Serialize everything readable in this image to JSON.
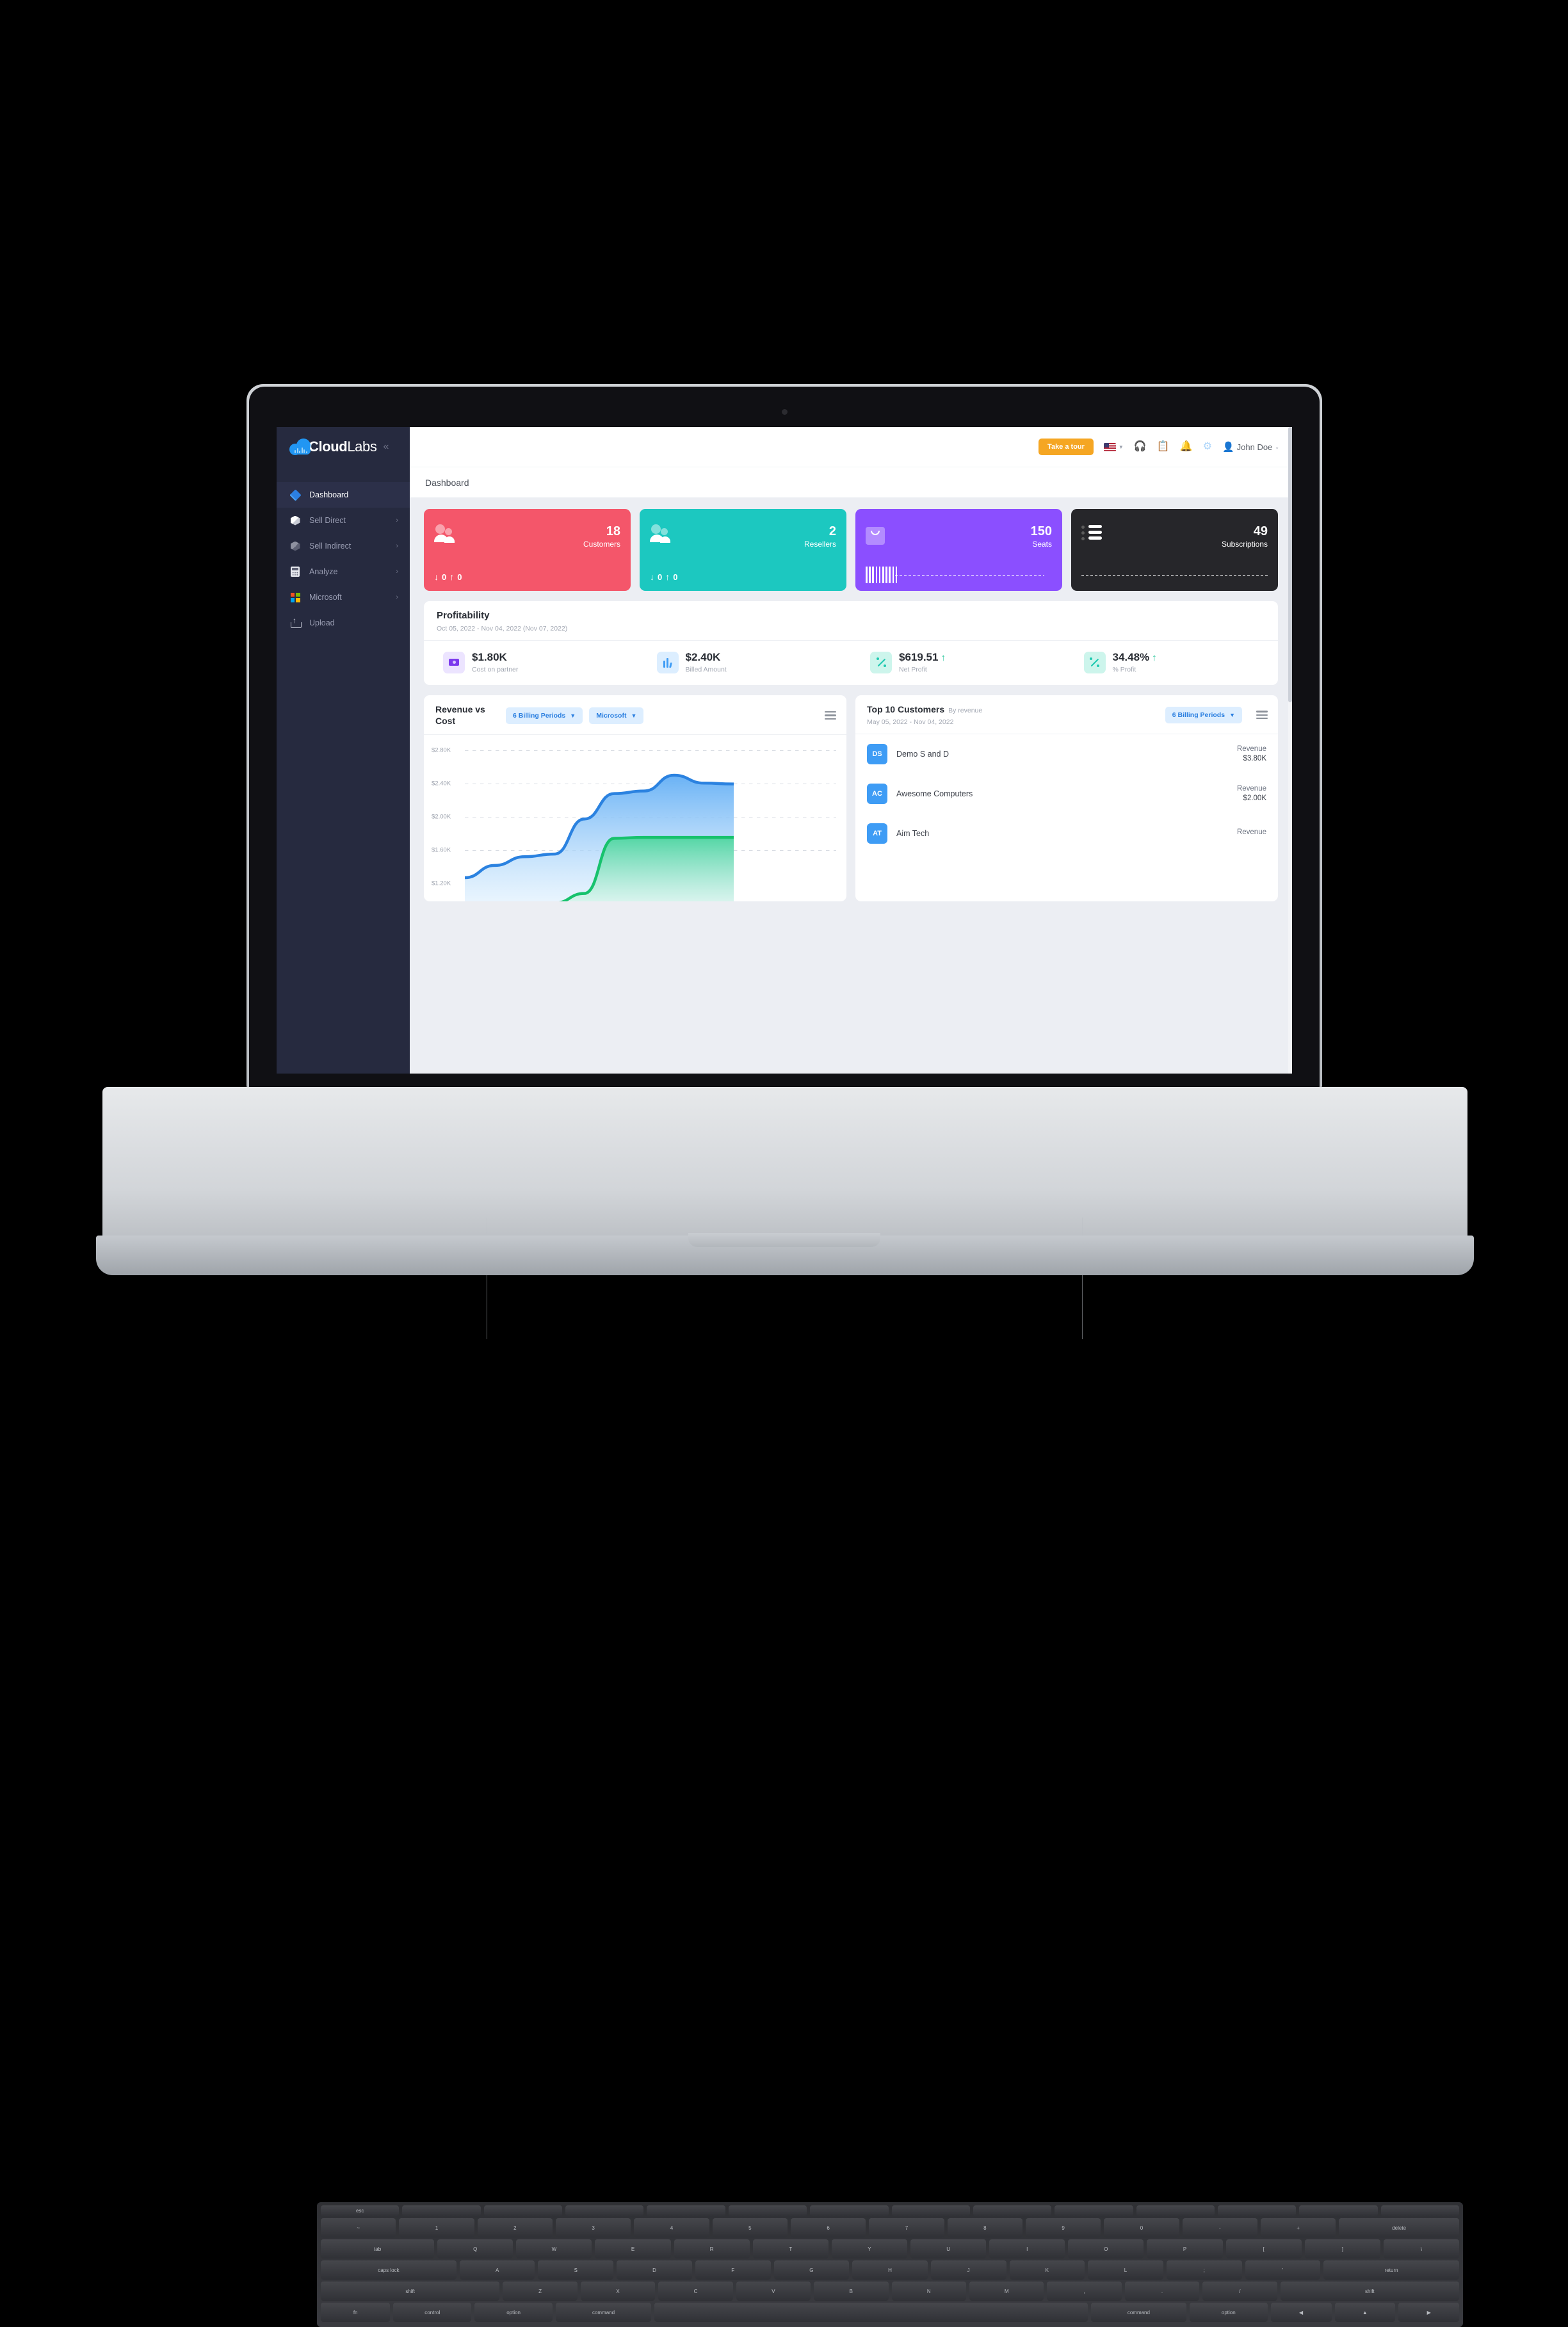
{
  "app": {
    "logo_main": "Cloud",
    "logo_sub": "Labs",
    "collapse_icon": "«"
  },
  "sidebar": {
    "items": [
      {
        "label": "Dashboard",
        "icon": "diamond-icon",
        "active": true,
        "chevron": ""
      },
      {
        "label": "Sell Direct",
        "icon": "cube-icon",
        "active": false,
        "chevron": "›"
      },
      {
        "label": "Sell Indirect",
        "icon": "cube-grey-icon",
        "active": false,
        "chevron": "›"
      },
      {
        "label": "Analyze",
        "icon": "calculator-icon",
        "active": false,
        "chevron": "›"
      },
      {
        "label": "Microsoft",
        "icon": "microsoft-icon",
        "active": false,
        "chevron": "›"
      },
      {
        "label": "Upload",
        "icon": "upload-icon",
        "active": false,
        "chevron": ""
      }
    ]
  },
  "topbar": {
    "take_tour": "Take a tour",
    "language_flag": "us-flag-icon",
    "icons": [
      "headset-icon",
      "clipboard-icon",
      "bell-icon",
      "gear-icon"
    ],
    "user_name": "John Doe",
    "user_caret": "⌄"
  },
  "page": {
    "title": "Dashboard"
  },
  "stat_cards": [
    {
      "value": "18",
      "label": "Customers",
      "color": "#f4566a",
      "down": "0",
      "up": "0",
      "icon": "people-icon"
    },
    {
      "value": "2",
      "label": "Resellers",
      "color": "#1cc8c0",
      "down": "0",
      "up": "0",
      "icon": "people-icon"
    },
    {
      "value": "150",
      "label": "Seats",
      "color": "#8b4fff",
      "icon": "bag-icon"
    },
    {
      "value": "49",
      "label": "Subscriptions",
      "color": "#26262a",
      "icon": "list-icon"
    }
  ],
  "profitability": {
    "title": "Profitability",
    "date_range": "Oct 05, 2022 - Nov 04, 2022 (Nov 07, 2022)",
    "metrics": [
      {
        "value": "$1.80K",
        "caption": "Cost on partner",
        "icon": "money-icon",
        "trend": "",
        "icon_bg": "#ece4ff"
      },
      {
        "value": "$2.40K",
        "caption": "Billed Amount",
        "icon": "bars-icon",
        "trend": "",
        "icon_bg": "#dceeff"
      },
      {
        "value": "$619.51",
        "caption": "Net Profit",
        "icon": "percent-icon",
        "trend": "↑",
        "icon_bg": "#cdf5ec"
      },
      {
        "value": "34.48%",
        "caption": "% Profit",
        "icon": "percent-icon",
        "trend": "↑",
        "icon_bg": "#cdf5ec"
      }
    ]
  },
  "revenue_panel": {
    "title": "Revenue vs Cost",
    "chip_period": "6 Billing Periods",
    "chip_vendor": "Microsoft",
    "menu_icon": "hamburger-icon"
  },
  "customers_panel": {
    "title": "Top 10 Customers",
    "title_suffix": "By revenue",
    "date_range": "May 05, 2022 - Nov 04, 2022",
    "chip_period": "6 Billing Periods",
    "menu_icon": "hamburger-icon",
    "revenue_label": "Revenue",
    "rows": [
      {
        "initials": "DS",
        "name": "Demo S and D",
        "revenue_label": "Revenue",
        "revenue": "$3.80K"
      },
      {
        "initials": "AC",
        "name": "Awesome Computers",
        "revenue_label": "Revenue",
        "revenue": "$2.00K"
      },
      {
        "initials": "AT",
        "name": "Aim Tech",
        "revenue_label": "Revenue",
        "revenue": ""
      }
    ]
  },
  "chart_data": {
    "type": "area",
    "title": "Revenue vs Cost",
    "xlabel": "",
    "ylabel": "",
    "ytick_labels": [
      "$2.80K",
      "$2.40K",
      "$2.00K",
      "$1.60K",
      "$1.20K"
    ],
    "yticks": [
      2800,
      2400,
      2000,
      1600,
      1200
    ],
    "ylim": [
      1060,
      2960
    ],
    "grid": true,
    "legend": "none",
    "x": [
      0,
      1,
      2,
      3,
      4,
      5,
      6,
      7,
      8
    ],
    "series": [
      {
        "name": "Revenue",
        "color": "#2b82e0",
        "values": [
          1330,
          1470,
          1570,
          1600,
          2000,
          2290,
          2320,
          2500,
          2410,
          2400
        ]
      },
      {
        "name": "Cost",
        "color": "#17c26d",
        "values": [
          1020,
          1020,
          1020,
          1040,
          1150,
          1780,
          1790,
          1790,
          1790,
          1790
        ]
      }
    ]
  }
}
